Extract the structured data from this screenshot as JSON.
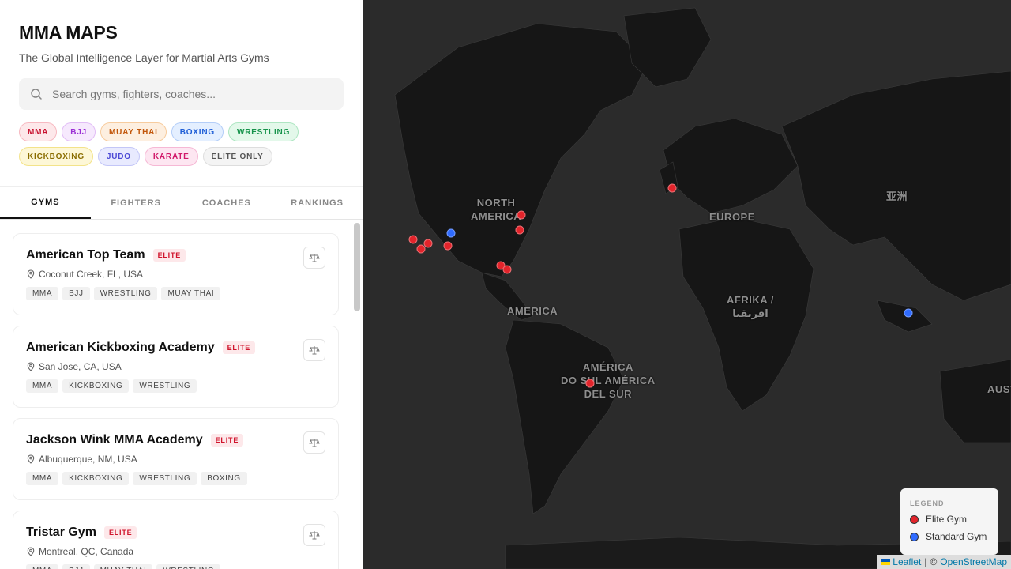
{
  "brand": {
    "title": "MMA MAPS",
    "subtitle": "The Global Intelligence Layer for Martial Arts Gyms"
  },
  "search": {
    "placeholder": "Search gyms, fighters, coaches...",
    "icon": "search-icon"
  },
  "filters": [
    {
      "label": "MMA",
      "bg": "#fde8ea",
      "fg": "#c8102e",
      "border": "#f7b9c1"
    },
    {
      "label": "BJJ",
      "bg": "#f6e9fd",
      "fg": "#9b2fd4",
      "border": "#e2bdf6"
    },
    {
      "label": "MUAY THAI",
      "bg": "#fdefe0",
      "fg": "#c2570b",
      "border": "#f7cc9e"
    },
    {
      "label": "BOXING",
      "bg": "#e4efff",
      "fg": "#1f5ed6",
      "border": "#b4cef8"
    },
    {
      "label": "WRESTLING",
      "bg": "#e3f8ea",
      "fg": "#15924a",
      "border": "#aee6c2"
    },
    {
      "label": "KICKBOXING",
      "bg": "#fdf7d7",
      "fg": "#8a6d00",
      "border": "#f3e38a"
    },
    {
      "label": "JUDO",
      "bg": "#e8eafe",
      "fg": "#4d4ad6",
      "border": "#c3c6f7"
    },
    {
      "label": "KARATE",
      "bg": "#fde6f1",
      "fg": "#d11a6b",
      "border": "#f6b8d5"
    },
    {
      "label": "ELITE ONLY",
      "bg": "#f4f4f4",
      "fg": "#555555",
      "border": "#dddddd"
    }
  ],
  "tabs": [
    {
      "label": "GYMS",
      "active": true
    },
    {
      "label": "FIGHTERS",
      "active": false
    },
    {
      "label": "COACHES",
      "active": false
    },
    {
      "label": "RANKINGS",
      "active": false
    }
  ],
  "gyms": [
    {
      "name": "American Top Team",
      "badge": "ELITE",
      "location": "Coconut Creek, FL, USA",
      "tags": [
        "MMA",
        "BJJ",
        "WRESTLING",
        "MUAY THAI"
      ]
    },
    {
      "name": "American Kickboxing Academy",
      "badge": "ELITE",
      "location": "San Jose, CA, USA",
      "tags": [
        "MMA",
        "KICKBOXING",
        "WRESTLING"
      ]
    },
    {
      "name": "Jackson Wink MMA Academy",
      "badge": "ELITE",
      "location": "Albuquerque, NM, USA",
      "tags": [
        "MMA",
        "KICKBOXING",
        "WRESTLING",
        "BOXING"
      ]
    },
    {
      "name": "Tristar Gym",
      "badge": "ELITE",
      "location": "Montreal, QC, Canada",
      "tags": [
        "MMA",
        "BJJ",
        "MUAY THAI",
        "WRESTLING"
      ]
    }
  ],
  "map": {
    "labels": [
      {
        "text": "NORTH\nAMERICA"
      },
      {
        "text": "EUROPE"
      },
      {
        "text": "AMERICA"
      },
      {
        "text": "AFRIKA /\nافريقيا"
      },
      {
        "text": "AMÉRICA\nDO SUL AMÉRICA\nDEL SUR"
      },
      {
        "text": "亚洲"
      },
      {
        "text": "AUSTRAL"
      }
    ],
    "colors": {
      "elite": "#e3242b",
      "standard": "#2f6bff"
    },
    "markers": [
      {
        "type": "elite"
      },
      {
        "type": "elite"
      },
      {
        "type": "elite"
      },
      {
        "type": "elite"
      },
      {
        "type": "standard"
      },
      {
        "type": "elite"
      },
      {
        "type": "elite"
      },
      {
        "type": "elite"
      },
      {
        "type": "elite"
      },
      {
        "type": "elite"
      },
      {
        "type": "elite"
      },
      {
        "type": "elite"
      },
      {
        "type": "standard"
      }
    ]
  },
  "legend": {
    "title": "LEGEND",
    "elite_label": "Elite Gym",
    "standard_label": "Standard Gym"
  },
  "attribution": {
    "leaflet": "Leaflet",
    "separator": "|",
    "copyright": "©",
    "osm": "OpenStreetMap"
  }
}
